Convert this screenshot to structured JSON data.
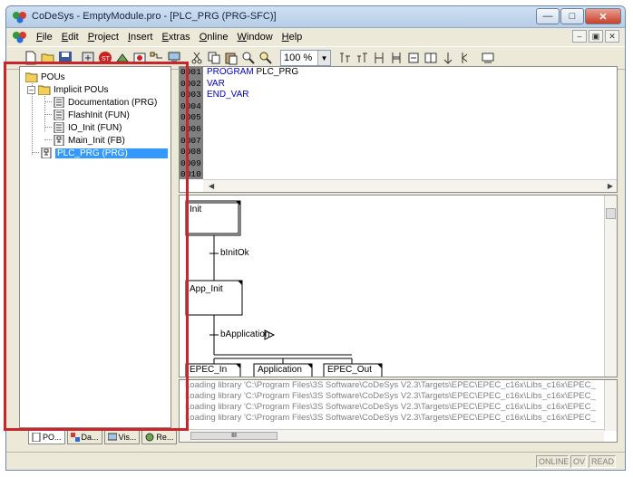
{
  "window": {
    "title": "CoDeSys - EmptyModule.pro - [PLC_PRG (PRG-SFC)]"
  },
  "menu": {
    "items": [
      {
        "u": "F",
        "rest": "ile"
      },
      {
        "u": "E",
        "rest": "dit"
      },
      {
        "u": "P",
        "rest": "roject"
      },
      {
        "u": "I",
        "rest": "nsert"
      },
      {
        "u": "E",
        "rest": "xtras"
      },
      {
        "u": "O",
        "rest": "nline"
      },
      {
        "u": "W",
        "rest": "indow"
      },
      {
        "u": "H",
        "rest": "elp"
      }
    ]
  },
  "toolbar": {
    "zoom": "100 %"
  },
  "tree": {
    "root": "POUs",
    "folder": "Implicit POUs",
    "items": [
      "Documentation (PRG)",
      "FlashInit (FUN)",
      "IO_Init (FUN)",
      "Main_Init (FB)"
    ],
    "selected": "PLC_PRG (PRG)"
  },
  "tabs": [
    "PO...",
    "Da...",
    "Vis...",
    "Re..."
  ],
  "code": {
    "line_numbers": [
      "0001",
      "0002",
      "0003",
      "0004",
      "0005",
      "0006",
      "0007",
      "0008",
      "0009",
      "0010"
    ],
    "lines": [
      {
        "kw": "PROGRAM",
        "rest": " PLC_PRG"
      },
      {
        "kw": "VAR",
        "rest": ""
      },
      {
        "kw": "END_VAR",
        "rest": ""
      }
    ]
  },
  "sfc": {
    "steps": [
      "Init",
      "App_Init",
      "EPEC_In",
      "Application",
      "EPEC_Out"
    ],
    "transitions": [
      "bInitOk",
      "bApplication"
    ]
  },
  "messages": [
    "Loading library 'C:\\Program Files\\3S Software\\CoDeSys V2.3\\Targets\\EPEC\\EPEC_c16x\\Libs_c16x\\EPEC_",
    "Loading library 'C:\\Program Files\\3S Software\\CoDeSys V2.3\\Targets\\EPEC\\EPEC_c16x\\Libs_c16x\\EPEC_",
    "Loading library 'C:\\Program Files\\3S Software\\CoDeSys V2.3\\Targets\\EPEC\\EPEC_c16x\\Libs_c16x\\EPEC_",
    "Loading library 'C:\\Program Files\\3S Software\\CoDeSys V2.3\\Targets\\EPEC\\EPEC_c16x\\Libs_c16x\\EPEC_"
  ],
  "msg_scroll_thumb": "III",
  "status": {
    "online": "ONLINE",
    "ov": "OV",
    "read": "READ"
  },
  "colors": {
    "highlight": "#c8262b",
    "selection": "#3399ff",
    "keyword": "#0000cc"
  }
}
